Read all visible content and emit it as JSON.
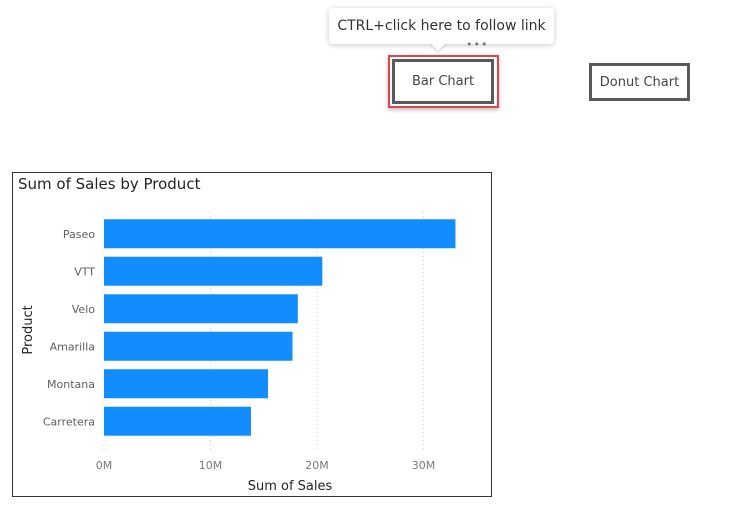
{
  "tooltip": {
    "text": "CTRL+click here to follow link"
  },
  "more_options": "•••",
  "buttons": {
    "bar_chart": "Bar Chart",
    "donut_chart": "Donut Chart"
  },
  "colors": {
    "bar": "#118DFF",
    "selection_outline": "#E5434B",
    "button_border": "#5A5A5A"
  },
  "chart_data": {
    "type": "bar",
    "orientation": "horizontal",
    "title": "Sum of Sales by Product",
    "xlabel": "Sum of Sales",
    "ylabel": "Product",
    "categories": [
      "Paseo",
      "VTT",
      "Velo",
      "Amarilla",
      "Montana",
      "Carretera"
    ],
    "values": [
      33.0,
      20.5,
      18.2,
      17.7,
      15.4,
      13.8
    ],
    "unit": "M",
    "xlim": [
      0,
      35
    ],
    "xticks": [
      0,
      10,
      20,
      30
    ],
    "xtick_labels": [
      "0M",
      "10M",
      "20M",
      "30M"
    ],
    "grid": true,
    "legend": "none"
  }
}
